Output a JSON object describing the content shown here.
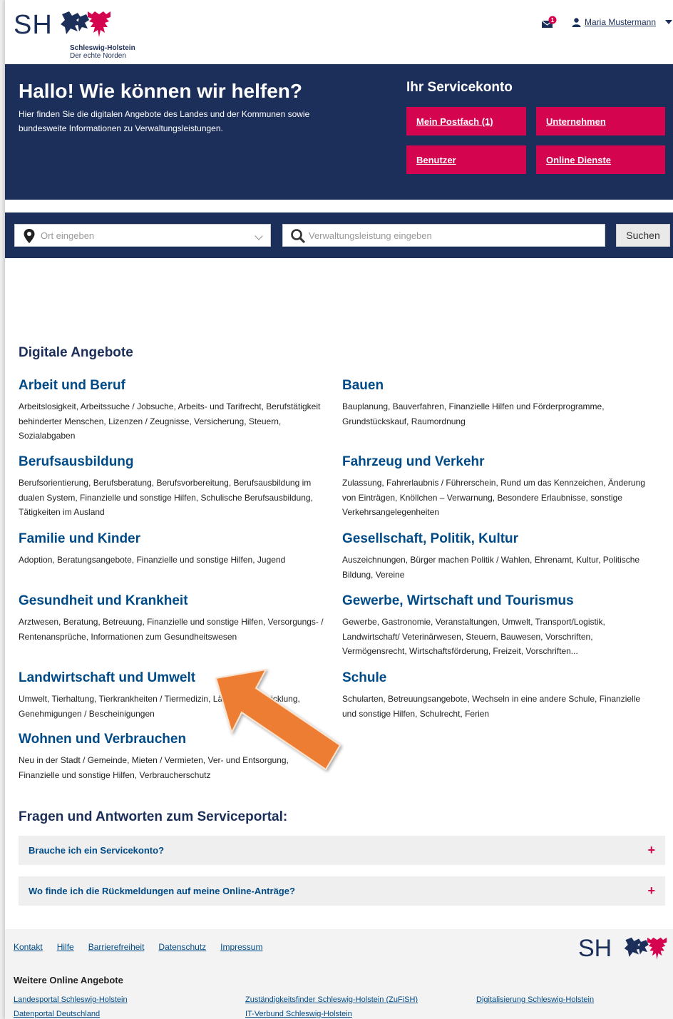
{
  "header": {
    "logo_text": "SH",
    "logo_sub_1": "Schleswig-Holstein",
    "logo_sub_2": "Der echte Norden",
    "mail_badge": "1",
    "user_name": "Maria Mustermann"
  },
  "hero": {
    "title": "Hallo! Wie können wir helfen?",
    "text": "Hier finden Sie die digitalen Angebote des Landes und der Kommunen sowie bundesweite Informationen zu Verwaltungsleistungen.",
    "service_title": "Ihr Servicekonto",
    "buttons": [
      "Mein Postfach (1)",
      "Unternehmen",
      "Benutzer",
      "Online Dienste"
    ]
  },
  "search": {
    "place_placeholder": "Ort eingeben",
    "service_placeholder": "Verwaltungsleistung eingeben",
    "button": "Suchen"
  },
  "offers": {
    "heading": "Digitale Angebote",
    "categories": [
      {
        "title": "Arbeit und Beruf",
        "desc": "Arbeitslosigkeit, Arbeitssuche / Jobsuche, Arbeits- und Tarifrecht, Berufstätigkeit behinderter Menschen, Lizenzen / Zeugnisse, Versicherung, Steuern, Sozialabgaben"
      },
      {
        "title": "Bauen",
        "desc": "Bauplanung, Bauverfahren, Finanzielle Hilfen und Förderprogramme, Grundstückskauf, Raumordnung"
      },
      {
        "title": "Berufsausbildung",
        "desc": "Berufsorientierung, Berufsberatung, Berufsvorbereitung, Berufsausbildung im dualen System, Finanzielle und sonstige Hilfen, Schulische Berufsausbildung, Tätigkeiten im Ausland"
      },
      {
        "title": "Fahrzeug und Verkehr",
        "desc": "Zulassung, Fahrerlaubnis / Führerschein, Rund um das Kennzeichen, Änderung von Einträgen, Knöllchen – Verwarnung, Besondere Erlaubnisse, sonstige Verkehrsangelegenheiten"
      },
      {
        "title": "Familie und Kinder",
        "desc": "Adoption, Beratungsangebote, Finanzielle und sonstige Hilfen, Jugend"
      },
      {
        "title": "Gesellschaft, Politik, Kultur",
        "desc": "Auszeichnungen, Bürger machen Politik / Wahlen, Ehrenamt, Kultur, Politische Bildung, Vereine"
      },
      {
        "title": "Gesundheit und Krankheit",
        "desc": "Arztwesen, Beratung, Betreuung, Finanzielle und sonstige Hilfen, Versorgungs- / Rentenansprüche, Informationen zum Gesundheitswesen"
      },
      {
        "title": "Gewerbe, Wirtschaft und Tourismus",
        "desc": "Gewerbe, Gastronomie, Veranstaltungen, Umwelt, Transport/Logistik, Landwirtschaft/ Veterinärwesen, Steuern, Bauwesen, Vorschriften, Vermögensrecht, Wirtschaftsförderung, Freizeit, Vorschriften..."
      },
      {
        "title": "Landwirtschaft und Umwelt",
        "desc": "Umwelt, Tierhaltung, Tierkrankheiten / Tiermedizin, Ländliche Entwicklung, Genehmigungen / Bescheinigungen"
      },
      {
        "title": "Schule",
        "desc": "Schularten, Betreuungsangebote, Wechseln in eine andere Schule, Finanzielle und sonstige Hilfen, Schulrecht, Ferien"
      },
      {
        "title": "Wohnen und Verbrauchen",
        "desc": "Neu in der Stadt / Gemeinde, Mieten / Vermieten, Ver- und Entsorgung, Finanzielle und sonstige Hilfen, Verbraucherschutz"
      }
    ]
  },
  "faq": {
    "heading": "Fragen und Antworten zum Serviceportal:",
    "items": [
      "Brauche ich ein Servicekonto?",
      "Wo finde ich die Rückmeldungen auf meine Online-Anträge?"
    ]
  },
  "footer": {
    "links": [
      "Kontakt",
      "Hilfe",
      "Barrierefreiheit",
      "Datenschutz",
      "Impressum"
    ],
    "logo_text": "SH",
    "more_title": "Weitere Online Angebote",
    "more_links": [
      "Landesportal Schleswig-Holstein",
      "Zuständigkeitsfinder Schleswig-Holstein (ZuFiSH)",
      "Digitalisierung Schleswig-Holstein",
      "Datenportal Deutschland",
      "IT-Verbund Schleswig-Holstein"
    ]
  },
  "colors": {
    "navy": "#1c2f5a",
    "magenta": "#d4044f",
    "link_blue": "#004b87",
    "arrow_orange": "#ed7d31"
  }
}
